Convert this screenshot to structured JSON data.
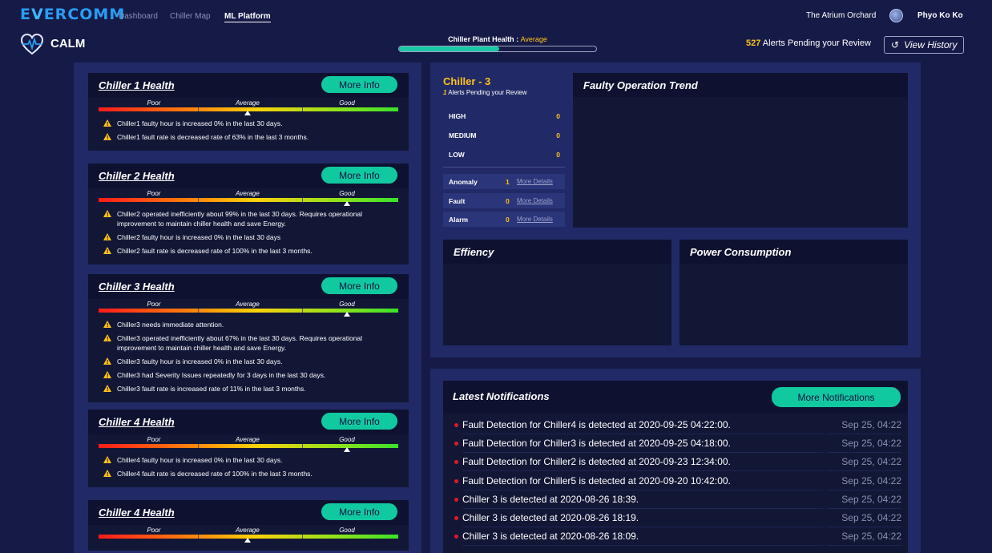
{
  "nav": {
    "logo_prefix": "E",
    "logo_v": "V",
    "logo_rest": "ERCOMM",
    "links": [
      "Dashboard",
      "Chiller Map",
      "ML Platform"
    ],
    "site": "The Atrium Orchard",
    "user": "Phyo Ko Ko",
    "user_caret": "⌄"
  },
  "header": {
    "app_name": "CALM",
    "plant_health_label": "Chiller Plant Health : ",
    "plant_health_value": "Average",
    "plant_health_progress": 0.51,
    "alerts_count": "527",
    "alerts_text": " Alerts Pending your Review",
    "view_history": "View History"
  },
  "scale_labels": {
    "poor": "Poor",
    "average": "Average",
    "good": "Good"
  },
  "more_info": "More Info",
  "chillers": [
    {
      "title": "Chiller 1 Health",
      "level": "average",
      "messages": [
        "Chiller1 faulty hour is increased 0% in the last 30 days.",
        "Chiller1 fault rate is decreased rate of 63% in the last 3 months."
      ]
    },
    {
      "title": "Chiller 2 Health",
      "level": "good",
      "messages": [
        "Chiller2 operated inefficiently about 99% in the last 30 days. Requires operational improvement to maintain chiller health and save Energy.",
        "Chiller2 faulty hour is increased 0% in the last 30 days",
        "Chiller2 fault rate is decreased rate of 100% in the last 3 months."
      ]
    },
    {
      "title": "Chiller 3 Health",
      "level": "good",
      "messages": [
        "Chiller3 needs immediate attention.",
        "Chiller3 operated inefficiently about 67% in the last 30 days. Requires operational improvement to maintain chiller health and save Energy.",
        "Chiller3 faulty hour is increased 0% in the last 30 days.",
        "Chiller3 had Severity Issues repeatedly for 3 days in the last 30 days.",
        "Chiller3 fault rate is increased rate of 11% in the last 3 months."
      ]
    },
    {
      "title": "Chiller 4 Health",
      "level": "good",
      "messages": [
        "Chiller4 faulty hour is increased 0% in the last 30 days.",
        "Chiller4 fault rate is decreased rate of 100% in the last 3 months."
      ]
    },
    {
      "title": "Chiller 4 Health",
      "level": "average",
      "messages": []
    }
  ],
  "summary": {
    "title": "Chiller - 3",
    "pending_count": "1",
    "pending_text": " Alerts Pending your Review",
    "severity": [
      {
        "label": "HIGH",
        "count": "0"
      },
      {
        "label": "MEDIUM",
        "count": "0"
      },
      {
        "label": "LOW",
        "count": "0"
      }
    ],
    "categories": [
      {
        "label": "Anomaly",
        "count": "1",
        "link": "More Details"
      },
      {
        "label": "Fault",
        "count": "0",
        "link": "More Details"
      },
      {
        "label": "Alarm",
        "count": "0",
        "link": "More Details"
      }
    ]
  },
  "charts": {
    "faulty_trend": "Faulty Operation Trend",
    "efficiency": "Effiency",
    "power": "Power Consumption"
  },
  "notifications": {
    "title": "Latest Notifications",
    "more_button": "More Notifications",
    "items": [
      {
        "text": "Fault Detection for Chiller4 is detected at 2020-09-25 04:22:00.",
        "time": "Sep 25, 04:22"
      },
      {
        "text": "Fault Detection for Chiller3 is detected at 2020-09-25 04:18:00.",
        "time": "Sep 25, 04:22"
      },
      {
        "text": "Fault Detection for Chiller2 is detected at 2020-09-23 12:34:00.",
        "time": "Sep 25, 04:22"
      },
      {
        "text": "Fault Detection for Chiller5 is detected at 2020-09-20 10:42:00.",
        "time": "Sep 25, 04:22"
      },
      {
        "text": "Chiller 3 is detected at 2020-08-26 18:39.",
        "time": "Sep 25, 04:22"
      },
      {
        "text": "Chiller 3 is detected at 2020-08-26 18:19.",
        "time": "Sep 25, 04:22"
      },
      {
        "text": "Chiller 3 is detected at 2020-08-26 18:09.",
        "time": "Sep 25, 04:22"
      }
    ]
  },
  "colors": {
    "background": "#151a47",
    "panel": "#212a66",
    "accent": "#11c9a0",
    "warning": "#ffc21a",
    "alert_dot": "#e0192b"
  }
}
